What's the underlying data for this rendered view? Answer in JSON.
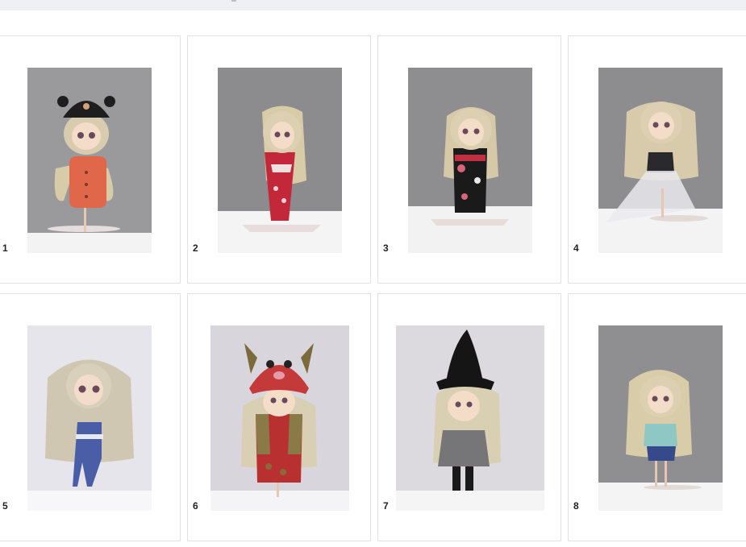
{
  "gallery": {
    "items": [
      {
        "number": "1",
        "photo": "doll-orange-knit-coat-bear-beanie"
      },
      {
        "number": "2",
        "photo": "doll-red-floral-kimono"
      },
      {
        "number": "3",
        "photo": "doll-black-floral-kimono"
      },
      {
        "number": "4",
        "photo": "doll-sheer-white-dress"
      },
      {
        "number": "5",
        "photo": "doll-blue-overalls"
      },
      {
        "number": "6",
        "photo": "doll-red-knit-dress-owl-hat"
      },
      {
        "number": "7",
        "photo": "doll-grey-coat-black-witch-hat"
      },
      {
        "number": "8",
        "photo": "doll-mint-top-denim-shorts"
      }
    ]
  },
  "colors": {
    "card_border": "#e2e2e2",
    "top_bar": "#eef0f4",
    "photo_background_grey": "#8e8e92",
    "photo_background_light": "#e4e3e9"
  }
}
